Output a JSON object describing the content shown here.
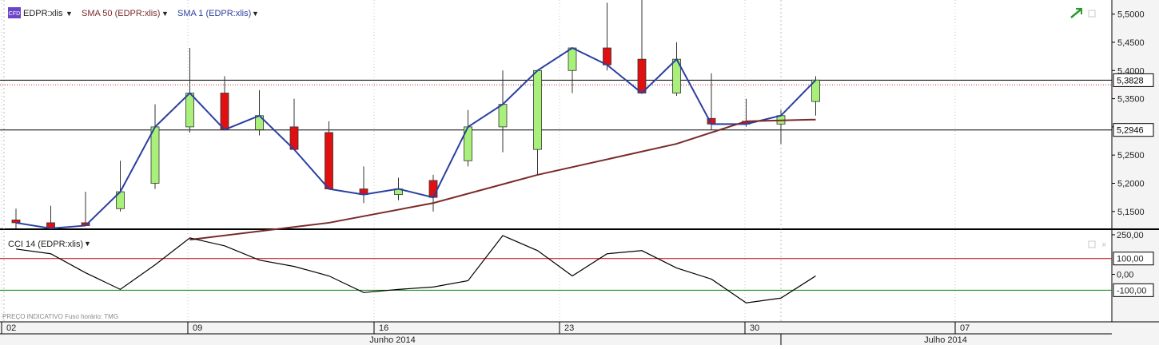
{
  "colors": {
    "up_candle": "#a8f07a",
    "down_candle": "#e01010",
    "sma1": "#2b3f9e",
    "sma50": "#7a2a2a",
    "cci": "#000000",
    "level_upper": "#c00000",
    "level_lower": "#008000",
    "price_label_bg": "#ffffff"
  },
  "legend": {
    "symbol_badge": "CFD",
    "symbol": "EDPR:xlis",
    "sma50": "SMA 50 (EDPR:xlis)",
    "sma1": "SMA 1 (EDPR:xlis)",
    "cci": "CCI 14 (EDPR:xlis)"
  },
  "footer_note": "PREÇO INDICATIVO   Fuso horário: TMG",
  "x_axis": {
    "day_labels": [
      "02",
      "09",
      "16",
      "23",
      "30",
      "07"
    ],
    "month_labels": [
      "Junho 2014",
      "Julho 2014"
    ]
  },
  "price_axis": {
    "ticks": [
      "5,5000",
      "5,4500",
      "5,4000",
      "5,3500",
      "5,3000",
      "5,2500",
      "5,2000",
      "5,1500"
    ],
    "ylim": [
      5.12,
      5.525
    ],
    "marked_levels": [
      {
        "label": "5,3828",
        "value": 5.3828
      },
      {
        "label": "5,2946",
        "value": 5.2946
      }
    ]
  },
  "cci_axis": {
    "ticks": [
      "250,00",
      "100,00",
      "0,00",
      "-100,00"
    ],
    "ylim": [
      -300,
      270
    ],
    "levels": [
      100,
      -100
    ]
  },
  "chart_data": [
    {
      "type": "candlestick",
      "title": "EDPR:xlis",
      "series": [
        {
          "name": "EDPR:xlis",
          "x": [
            "2014-06-02",
            "2014-06-03",
            "2014-06-04",
            "2014-06-05",
            "2014-06-06",
            "2014-06-09",
            "2014-06-10",
            "2014-06-11",
            "2014-06-12",
            "2014-06-13",
            "2014-06-16",
            "2014-06-17",
            "2014-06-18",
            "2014-06-19",
            "2014-06-20",
            "2014-06-23",
            "2014-06-24",
            "2014-06-25",
            "2014-06-26",
            "2014-06-27",
            "2014-06-30",
            "2014-07-01",
            "2014-07-02",
            "2014-07-03"
          ],
          "open": [
            5.135,
            5.13,
            5.13,
            5.155,
            5.2,
            5.3,
            5.36,
            5.295,
            5.3,
            5.29,
            5.19,
            5.18,
            5.205,
            5.24,
            5.3,
            5.26,
            5.4,
            5.44,
            5.42,
            5.36,
            5.315,
            5.31,
            5.305,
            5.345
          ],
          "high": [
            5.155,
            5.16,
            5.185,
            5.24,
            5.34,
            5.44,
            5.39,
            5.365,
            5.35,
            5.31,
            5.23,
            5.21,
            5.215,
            5.33,
            5.4,
            5.33,
            5.43,
            5.52,
            5.53,
            5.45,
            5.395,
            5.35,
            5.33,
            5.39
          ],
          "low": [
            5.12,
            5.125,
            5.125,
            5.15,
            5.19,
            5.29,
            5.315,
            5.285,
            5.275,
            5.255,
            5.165,
            5.17,
            5.15,
            5.23,
            5.255,
            5.215,
            5.36,
            5.4,
            5.4,
            5.355,
            5.295,
            5.3,
            5.27,
            5.32
          ],
          "close": [
            5.13,
            5.12,
            5.125,
            5.185,
            5.3,
            5.36,
            5.295,
            5.32,
            5.26,
            5.19,
            5.18,
            5.19,
            5.175,
            5.3,
            5.34,
            5.4,
            5.44,
            5.41,
            5.36,
            5.42,
            5.305,
            5.305,
            5.32,
            5.383
          ]
        },
        {
          "name": "SMA 50 (EDPR:xlis)",
          "x": [
            "2014-06-09",
            "2014-06-13",
            "2014-06-18",
            "2014-06-23",
            "2014-06-27",
            "2014-07-01",
            "2014-07-03"
          ],
          "values": [
            5.1,
            5.13,
            5.165,
            5.215,
            5.27,
            5.31,
            5.313
          ]
        }
      ],
      "ylim": [
        5.12,
        5.525
      ]
    },
    {
      "type": "line",
      "title": "CCI 14 (EDPR:xlis)",
      "series": [
        {
          "name": "CCI 14 (EDPR:xlis)",
          "x": [
            "2014-06-02",
            "2014-06-03",
            "2014-06-04",
            "2014-06-05",
            "2014-06-06",
            "2014-06-09",
            "2014-06-10",
            "2014-06-11",
            "2014-06-12",
            "2014-06-13",
            "2014-06-16",
            "2014-06-17",
            "2014-06-18",
            "2014-06-19",
            "2014-06-20",
            "2014-06-23",
            "2014-06-24",
            "2014-06-25",
            "2014-06-26",
            "2014-06-27",
            "2014-06-30",
            "2014-07-01",
            "2014-07-02",
            "2014-07-03"
          ],
          "values": [
            160,
            130,
            10,
            -95,
            60,
            230,
            180,
            90,
            50,
            -10,
            -115,
            -95,
            -80,
            -40,
            245,
            150,
            -10,
            130,
            150,
            40,
            -30,
            -180,
            -150,
            -10
          ]
        }
      ],
      "ylim": [
        -300,
        270
      ]
    }
  ]
}
